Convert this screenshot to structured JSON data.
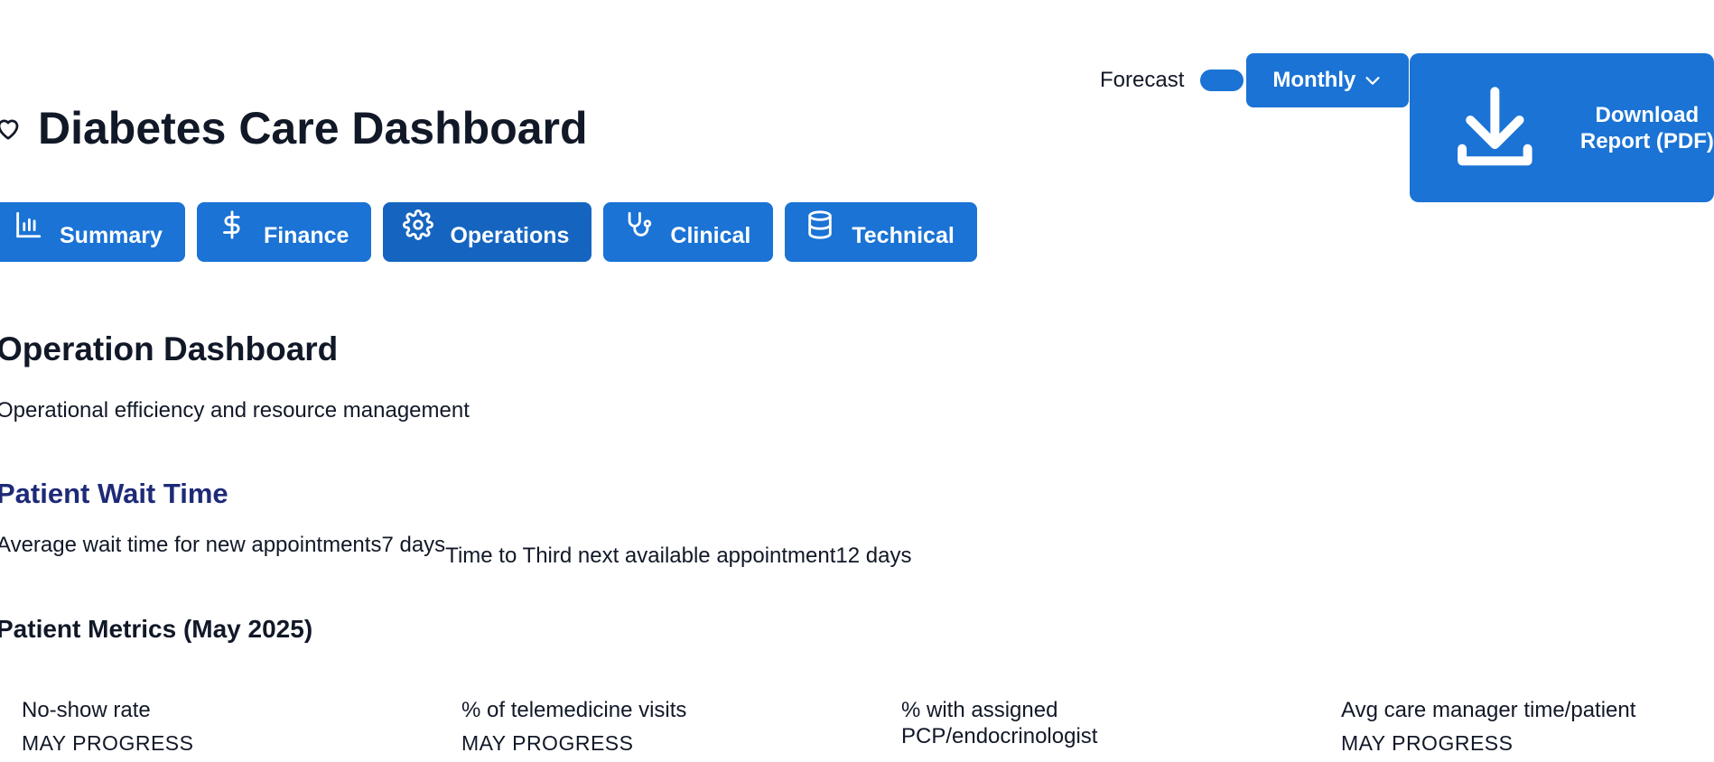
{
  "header": {
    "title": "Diabetes Care Dashboard",
    "forecast_label": "Forecast",
    "period_select": "Monthly",
    "download_label": "Download Report (PDF)"
  },
  "tabs": [
    {
      "label": "Summary",
      "icon": "bar-chart-icon"
    },
    {
      "label": "Finance",
      "icon": "dollar-icon"
    },
    {
      "label": "Operations",
      "icon": "gear-icon"
    },
    {
      "label": "Clinical",
      "icon": "stethoscope-icon"
    },
    {
      "label": "Technical",
      "icon": "database-icon"
    }
  ],
  "section": {
    "title": "Operation Dashboard",
    "subtitle": "Operational efficiency and resource management"
  },
  "wait_time": {
    "title": "Patient Wait Time",
    "items": [
      {
        "label": "Average wait time for new appointments",
        "value": "7 days"
      },
      {
        "label": "Time to Third next available appointment",
        "value": "12 days"
      }
    ]
  },
  "metrics": {
    "title": "Patient Metrics (May 2025)",
    "cards": [
      {
        "label": "No-show rate",
        "progress": "MAY PROGRESS"
      },
      {
        "label": "% of telemedicine visits",
        "progress": "MAY PROGRESS"
      },
      {
        "label": "% with assigned PCP/endocrinologist",
        "progress": ""
      },
      {
        "label": "Avg care manager time/patient",
        "progress": "MAY PROGRESS"
      }
    ]
  },
  "colors": {
    "primary": "#1a73d5",
    "primary_active": "#1565c0",
    "heading_navy": "#1e2a78",
    "text": "#111827"
  }
}
